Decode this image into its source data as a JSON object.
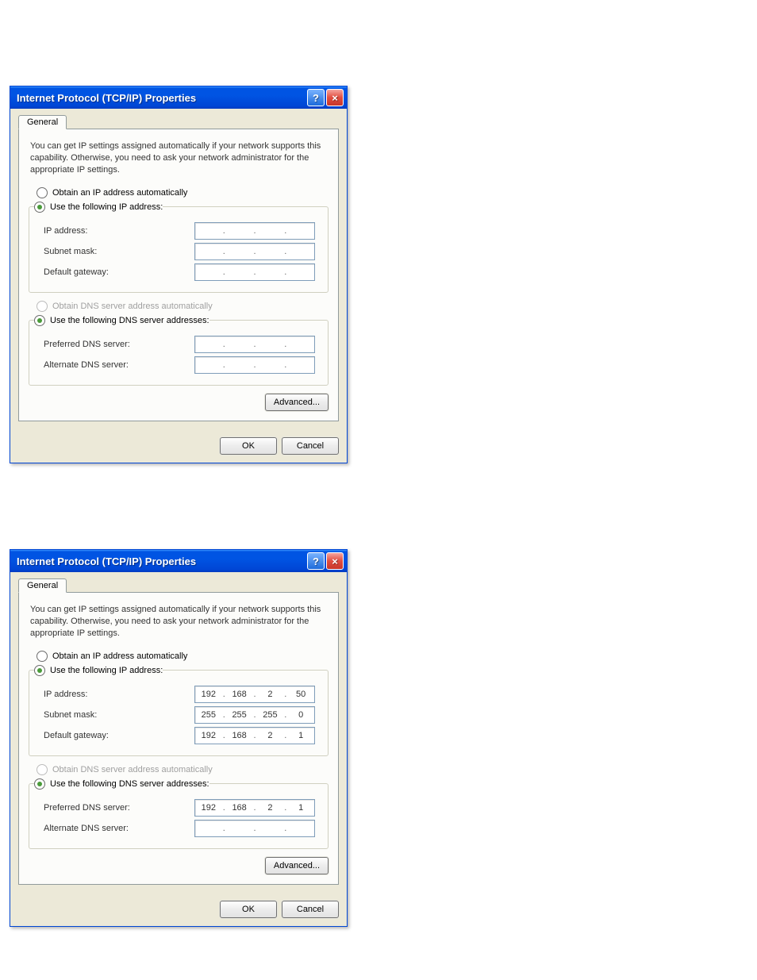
{
  "dialogs": [
    {
      "title": "Internet Protocol (TCP/IP) Properties",
      "tab": "General",
      "description": "You can get IP settings assigned automatically if your network supports this capability. Otherwise, you need to ask your network administrator for the appropriate IP settings.",
      "radio_obtain_ip": "Obtain an IP address automatically",
      "radio_use_ip": "Use the following IP address:",
      "labels": {
        "ip_address": "IP address:",
        "subnet_mask": "Subnet mask:",
        "default_gateway": "Default gateway:",
        "preferred_dns": "Preferred DNS server:",
        "alternate_dns": "Alternate DNS server:"
      },
      "radio_obtain_dns": "Obtain DNS server address automatically",
      "radio_use_dns": "Use the following DNS server addresses:",
      "ip_values": {
        "ip_address": [
          "",
          "",
          "",
          ""
        ],
        "subnet_mask": [
          "",
          "",
          "",
          ""
        ],
        "default_gateway": [
          "",
          "",
          "",
          ""
        ],
        "preferred_dns": [
          "",
          "",
          "",
          ""
        ],
        "alternate_dns": [
          "",
          "",
          "",
          ""
        ]
      },
      "buttons": {
        "advanced": "Advanced...",
        "ok": "OK",
        "cancel": "Cancel"
      }
    },
    {
      "title": "Internet Protocol (TCP/IP) Properties",
      "tab": "General",
      "description": "You can get IP settings assigned automatically if your network supports this capability. Otherwise, you need to ask your network administrator for the appropriate IP settings.",
      "radio_obtain_ip": "Obtain an IP address automatically",
      "radio_use_ip": "Use the following IP address:",
      "labels": {
        "ip_address": "IP address:",
        "subnet_mask": "Subnet mask:",
        "default_gateway": "Default gateway:",
        "preferred_dns": "Preferred DNS server:",
        "alternate_dns": "Alternate DNS server:"
      },
      "radio_obtain_dns": "Obtain DNS server address automatically",
      "radio_use_dns": "Use the following DNS server addresses:",
      "ip_values": {
        "ip_address": [
          "192",
          "168",
          "2",
          "50"
        ],
        "subnet_mask": [
          "255",
          "255",
          "255",
          "0"
        ],
        "default_gateway": [
          "192",
          "168",
          "2",
          "1"
        ],
        "preferred_dns": [
          "192",
          "168",
          "2",
          "1"
        ],
        "alternate_dns": [
          "",
          "",
          "",
          ""
        ]
      },
      "buttons": {
        "advanced": "Advanced...",
        "ok": "OK",
        "cancel": "Cancel"
      }
    }
  ]
}
